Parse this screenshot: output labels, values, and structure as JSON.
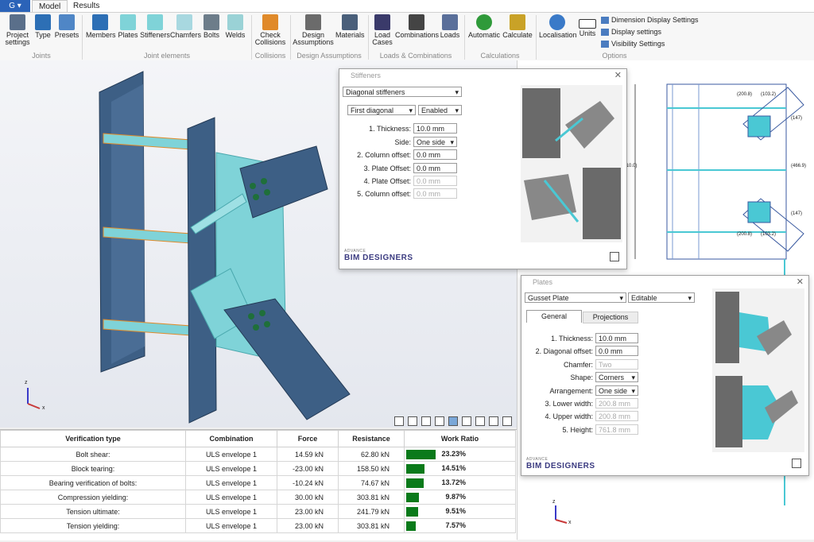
{
  "app": {
    "logo": "G",
    "tabs": [
      "Model",
      "Results"
    ]
  },
  "ribbon": {
    "groups": [
      {
        "label": "Joints",
        "buttons": [
          "Project settings",
          "Type",
          "Presets"
        ]
      },
      {
        "label": "Joint elements",
        "buttons": [
          "Members",
          "Plates",
          "Stiffeners",
          "Chamfers",
          "Bolts",
          "Welds"
        ]
      },
      {
        "label": "Collisions",
        "buttons": [
          "Check Collisions"
        ]
      },
      {
        "label": "Design Assumptions",
        "buttons": [
          "Design Assumptions",
          "Materials"
        ]
      },
      {
        "label": "Loads & Combinations",
        "buttons": [
          "Load Cases",
          "Combinations",
          "Loads"
        ]
      },
      {
        "label": "Calculations",
        "buttons": [
          "Automatic",
          "Calculate"
        ]
      },
      {
        "label": "Options",
        "buttons": [
          "Localisation",
          "Units"
        ]
      }
    ],
    "options": [
      "Dimension Display Settings",
      "Display settings",
      "Visibility Settings"
    ]
  },
  "stiffeners": {
    "title": "Stiffeners",
    "type": "Diagonal stiffeners",
    "diagonal": "First diagonal",
    "state": "Enabled",
    "fields": [
      {
        "label": "1. Thickness:",
        "value": "10.0 mm",
        "enabled": true
      },
      {
        "label": "Side:",
        "value": "One side",
        "enabled": true
      },
      {
        "label": "2. Column offset:",
        "value": "0.0 mm",
        "enabled": true
      },
      {
        "label": "3. Plate Offset:",
        "value": "0.0 mm",
        "enabled": true
      },
      {
        "label": "4. Plate Offset:",
        "value": "0.0 mm",
        "enabled": false
      },
      {
        "label": "5. Column offset:",
        "value": "0.0 mm",
        "enabled": false
      }
    ]
  },
  "plates": {
    "title": "Plates",
    "type": "Gusset Plate",
    "mode": "Editable",
    "tabs": [
      "General",
      "Projections"
    ],
    "fields": [
      {
        "label": "1. Thickness:",
        "value": "10.0 mm",
        "enabled": true
      },
      {
        "label": "2. Diagonal offset:",
        "value": "0.0 mm",
        "enabled": true
      },
      {
        "label": "Chamfer:",
        "value": "Two",
        "enabled": false
      },
      {
        "label": "Shape:",
        "value": "Corners",
        "enabled": true
      },
      {
        "label": "Arrangement:",
        "value": "One side",
        "enabled": true
      },
      {
        "label": "3. Lower width:",
        "value": "200.8 mm",
        "enabled": false
      },
      {
        "label": "4. Upper width:",
        "value": "200.8 mm",
        "enabled": false
      },
      {
        "label": "5. Height:",
        "value": "761.8 mm",
        "enabled": false
      }
    ]
  },
  "brand": {
    "small": "ADVANCE",
    "name": "BIM DESIGNERS"
  },
  "verification": {
    "headers": [
      "Verification type",
      "Combination",
      "Force",
      "Resistance",
      "Work Ratio"
    ],
    "rows": [
      {
        "type": "Bolt shear:",
        "combination": "ULS envelope 1",
        "force": "14.59 kN",
        "resistance": "62.80 kN",
        "ratio": "23.23%",
        "pct": 23.23
      },
      {
        "type": "Block tearing:",
        "combination": "ULS envelope 1",
        "force": "-23.00 kN",
        "resistance": "158.50 kN",
        "ratio": "14.51%",
        "pct": 14.51
      },
      {
        "type": "Bearing verification of bolts:",
        "combination": "ULS envelope 1",
        "force": "-10.24 kN",
        "resistance": "74.67 kN",
        "ratio": "13.72%",
        "pct": 13.72
      },
      {
        "type": "Compression yielding:",
        "combination": "ULS envelope 1",
        "force": "30.00 kN",
        "resistance": "303.81 kN",
        "ratio": "9.87%",
        "pct": 9.87
      },
      {
        "type": "Tension ultimate:",
        "combination": "ULS envelope 1",
        "force": "23.00 kN",
        "resistance": "241.79 kN",
        "ratio": "9.51%",
        "pct": 9.51
      },
      {
        "type": "Tension yielding:",
        "combination": "ULS envelope 1",
        "force": "23.00 kN",
        "resistance": "303.81 kN",
        "ratio": "7.57%",
        "pct": 7.57
      }
    ]
  },
  "drawing": {
    "dims": [
      "(200.8)",
      "(103.2)",
      "(200.8)",
      "(103.2)",
      "(1010.0)",
      "(466.9)",
      "(147)",
      "(147)"
    ],
    "axes": [
      "z",
      "x"
    ]
  },
  "colors": {
    "accent": "#2b63b8",
    "steel": "#3d5f85",
    "gusset": "#7fd3d8",
    "bar": "#0a7a1a"
  }
}
